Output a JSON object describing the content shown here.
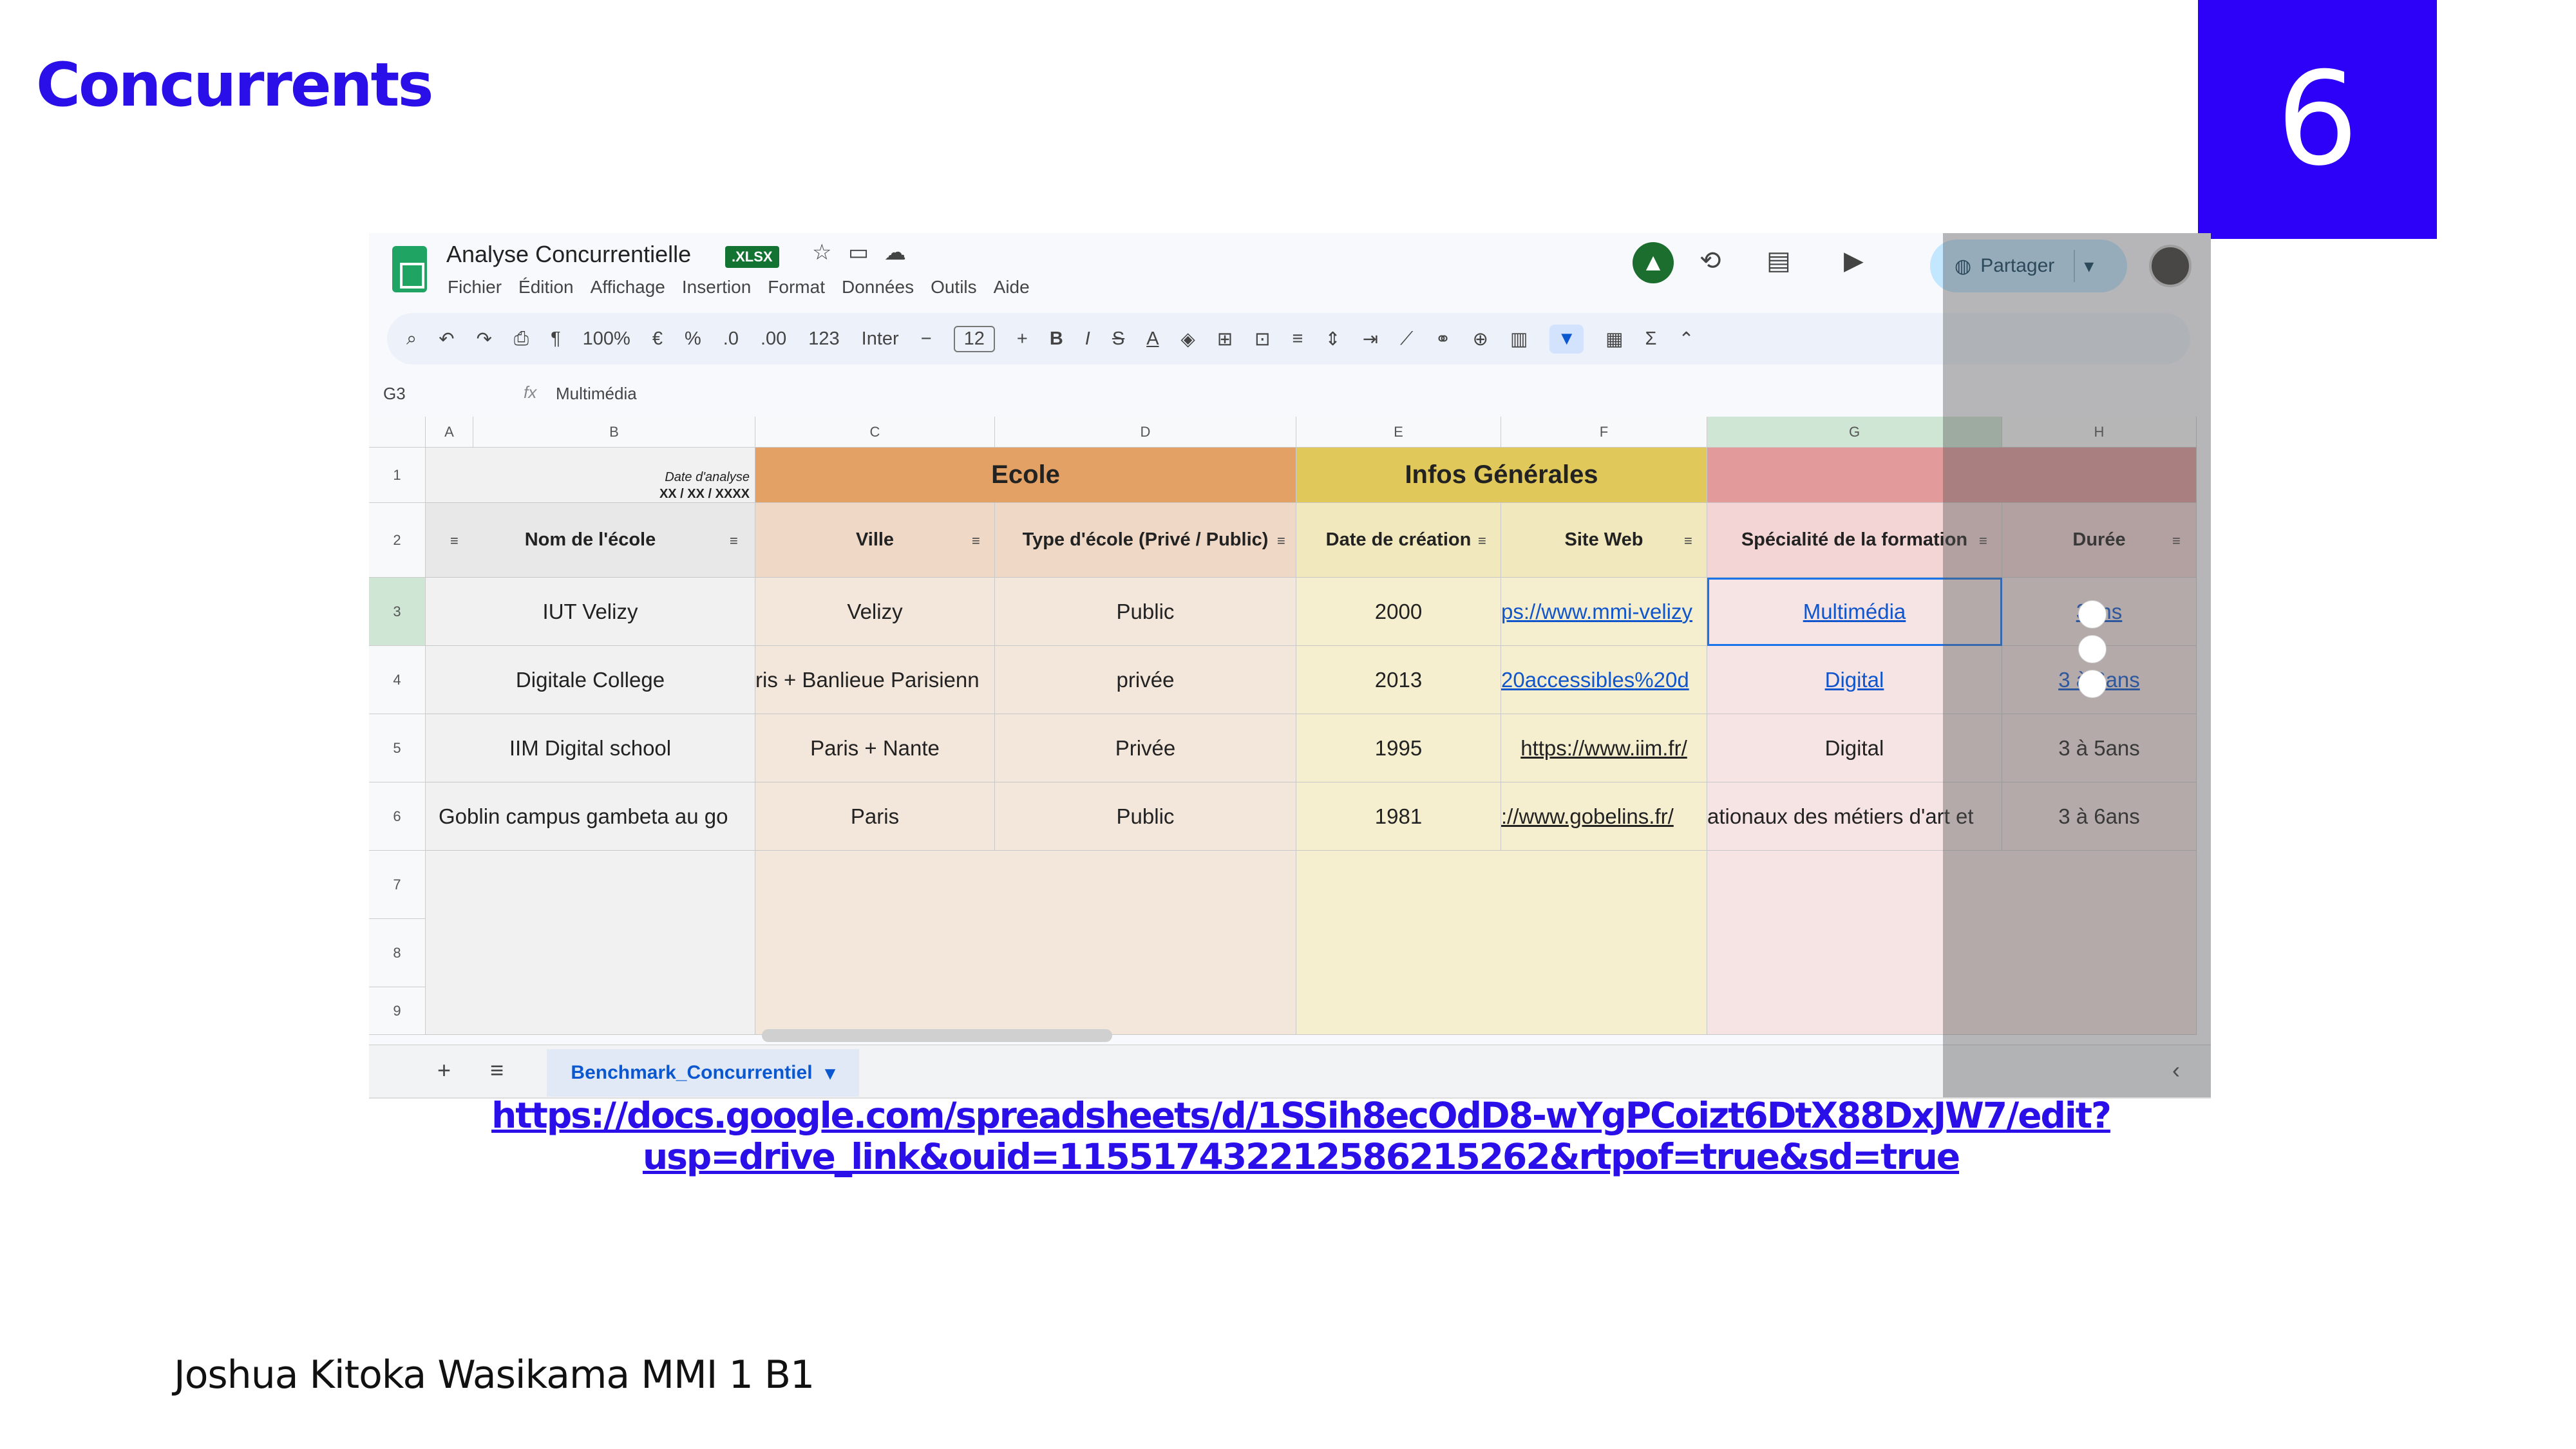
{
  "slide": {
    "title": "Concurrents",
    "page_number": "6",
    "author": "Joshua Kitoka Wasikama MMI 1 B1",
    "link_line1": "https://docs.google.com/spreadsheets/d/1SSih8ecOdD8-wYgPCoizt6DtX88DxJW7/edit?",
    "link_line2": "usp=drive_link&ouid=115517432212586215262&rtpof=true&sd=true"
  },
  "sheets": {
    "doc_title": "Analyse Concurrentielle",
    "badge": ".XLSX",
    "menu": [
      "Fichier",
      "Édition",
      "Affichage",
      "Insertion",
      "Format",
      "Données",
      "Outils",
      "Aide"
    ],
    "share_label": "Partager",
    "toolbar": {
      "zoom": "100%",
      "currency": "€",
      "percent": "%",
      "dec_minus": ".0",
      "dec_plus": ".00",
      "number_format": "123",
      "font": "Inter",
      "font_size": "12"
    },
    "cell_ref": "G3",
    "formula_value": "Multimédia",
    "columns": [
      "A",
      "B",
      "C",
      "D",
      "E",
      "F",
      "G",
      "H"
    ],
    "rows": [
      "1",
      "2",
      "3",
      "4",
      "5",
      "6",
      "7",
      "8",
      "9"
    ],
    "date_label": "Date d'analyse",
    "date_value": "XX / XX / XXXX",
    "group_ecole": "Ecole",
    "group_infos": "Infos Générales",
    "headers": [
      "Nom de l'école",
      "Ville",
      "Type d'école (Privé / Public)",
      "Date de création",
      "Site Web",
      "Spécialité de la formation",
      "Durée"
    ],
    "data": [
      [
        "IUT Velizy",
        "Velizy",
        "Public",
        "2000",
        "ps://www.mmi-velizy",
        "Multimédia",
        "3ans"
      ],
      [
        "Digitale College",
        "ris + Banlieue Parisienn",
        "privée",
        "2013",
        "20accessibles%20d",
        "Digital",
        "3 à 6ans"
      ],
      [
        "IIM Digital school",
        "Paris + Nante",
        "Privée",
        "1995",
        "https://www.iim.fr/",
        "Digital",
        "3 à 5ans"
      ],
      [
        "Goblin campus gambeta au go",
        "Paris",
        "Public",
        "1981",
        "://www.gobelins.fr/",
        "ationaux des métiers d'art et",
        "3 à 6ans"
      ]
    ],
    "sheet_tab": "Benchmark_Concurrentiel"
  },
  "colors": {
    "accent": "#2d00f7",
    "ecole": "#e3a165",
    "infos": "#e0c95a",
    "speciality": "#e39a9a",
    "sheets_green": "#1fa463"
  }
}
